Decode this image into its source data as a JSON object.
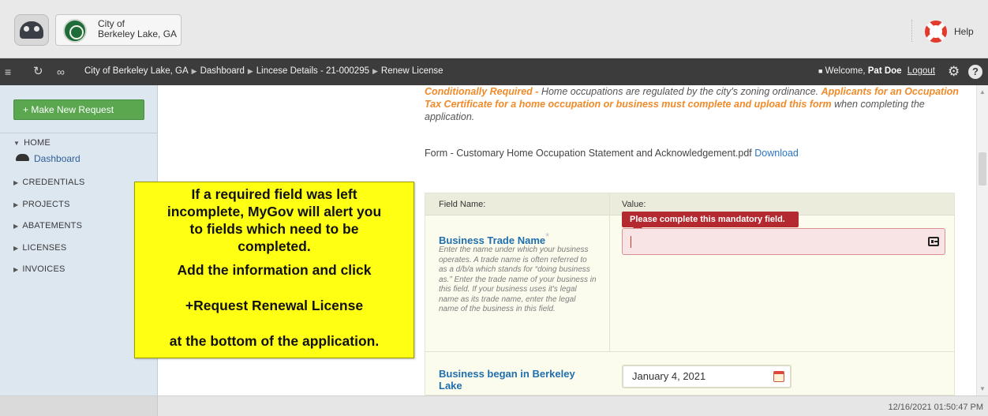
{
  "header": {
    "city_line1": "City of",
    "city_line2": "Berkeley Lake, GA",
    "help_label": "Help"
  },
  "navbar": {
    "breadcrumbs": [
      "City of Berkeley Lake, GA",
      "Dashboard",
      "Lincese Details - 21-000295",
      "Renew License"
    ],
    "welcome_prefix": "Welcome,",
    "user_name": "Pat Doe",
    "logout_label": "Logout"
  },
  "sidebar": {
    "new_request_label": "+ Make New Request",
    "home_label": "HOME",
    "dashboard_label": "Dashboard",
    "sections": [
      "CREDENTIALS",
      "PROJECTS",
      "ABATEMENTS",
      "LICENSES",
      "INVOICES"
    ]
  },
  "main": {
    "conditional_required": "Conditionally Required -",
    "conditional_text": "Home occupations are regulated by the city's zoning ordinance.",
    "applicants_text": "Applicants for an Occupation Tax Certificate for a home occupation or business must complete and upload this form",
    "when_text": "when completing the application.",
    "form_prefix": "Form - Customary Home Occupation Statement and Acknowledgement.pdf",
    "download_label": "Download",
    "field_name_header": "Field Name:",
    "value_header": "Value:",
    "business_trade_name_label": "Business Trade Name",
    "required_star": "*",
    "business_trade_name_desc": "Enter the name under which your business operates. A trade name is often referred to as a d/b/a which stands for “doing business as.” Enter the trade name of your business in this field. If your business uses it's legal name as its trade name, enter the legal name of the business in this field.",
    "error_tooltip": "Please complete this mandatory field.",
    "business_began_label_line1": "Business began in Berkeley",
    "business_began_label_line2": "Lake",
    "business_began_value": "January 4, 2021"
  },
  "callout": {
    "lines": [
      "If a required field was left",
      "incomplete, MyGov will alert you",
      "to fields which need to be",
      "completed.",
      "Add the information and click",
      "+Request Renewal License",
      "at the bottom of the application."
    ]
  },
  "footer": {
    "timestamp": "12/16/2021 01:50:47 PM"
  },
  "colors": {
    "accent_orange": "#f08b2a",
    "link_blue": "#2a74c5",
    "field_label_blue": "#1f6fae",
    "error_red": "#b4282f",
    "callout_yellow": "#ffff14",
    "button_green": "#5aa750"
  }
}
